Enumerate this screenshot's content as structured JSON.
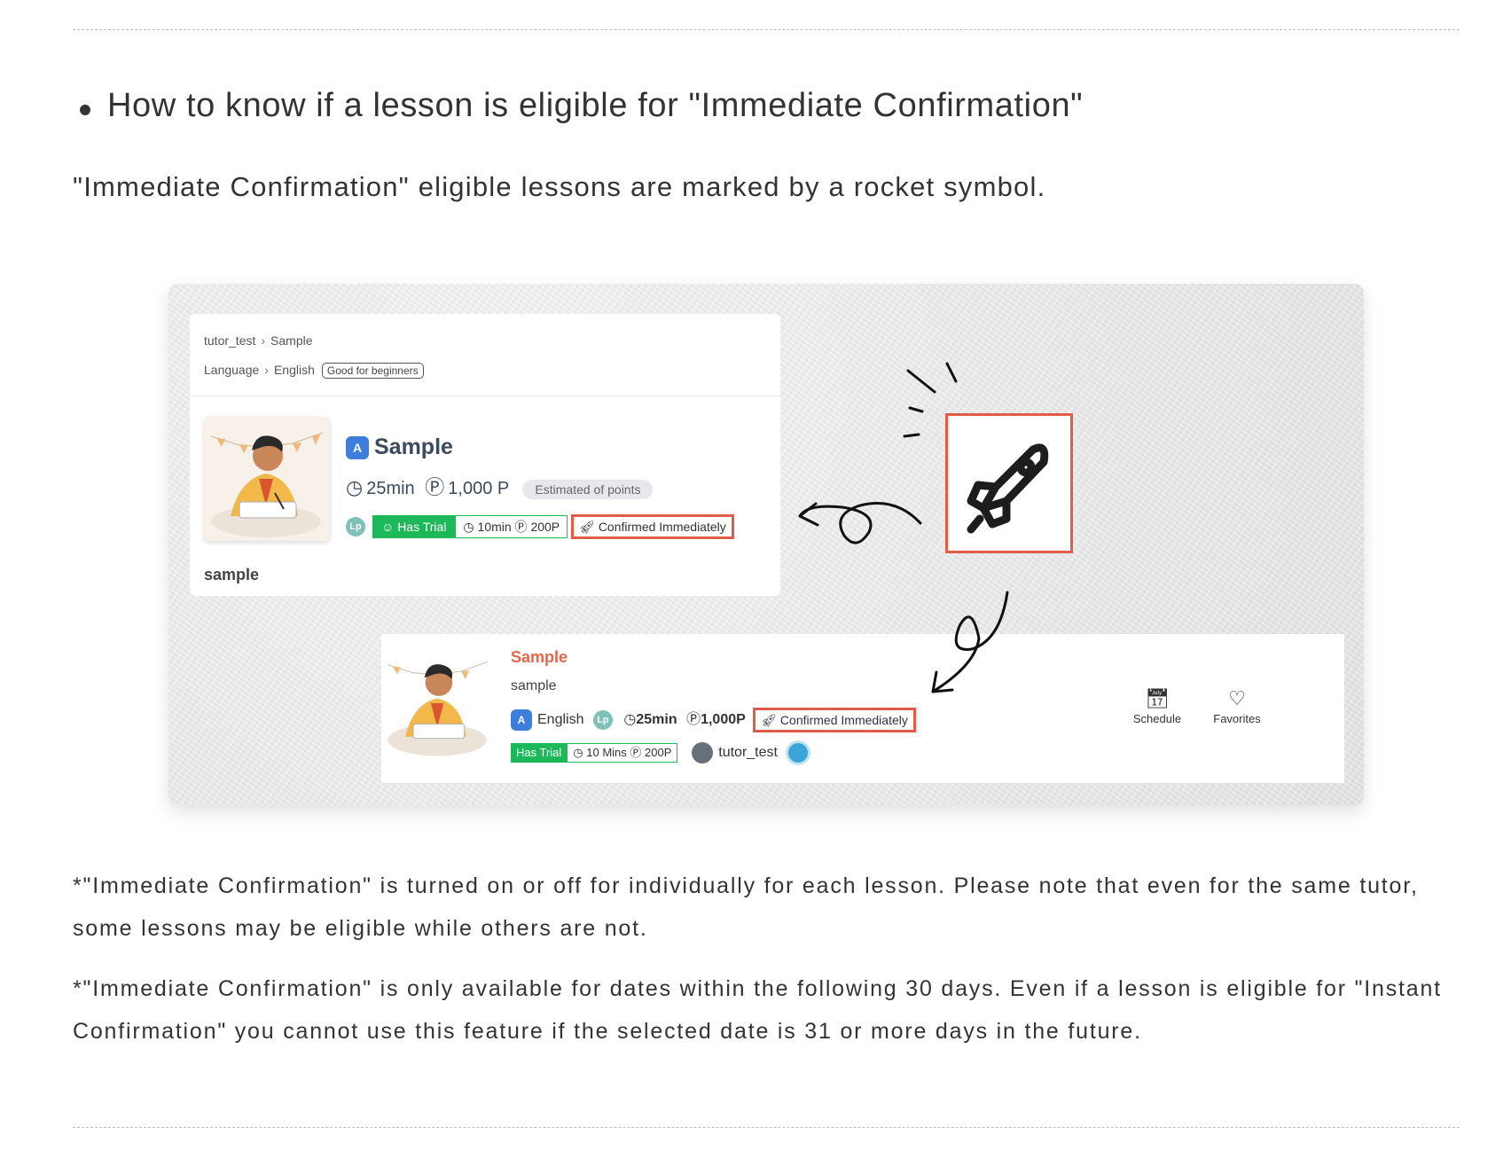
{
  "heading": "How to know if a lesson is eligible for \"Immediate Confirmation\"",
  "intro": "\"Immediate Confirmation\" eligible lessons are marked by a rocket symbol.",
  "figure": {
    "card1": {
      "crumb1": "tutor_test",
      "crumb2": "Sample",
      "crumb3": "Language",
      "crumb4": "English",
      "level_tag": "Good for beginners",
      "app_letter": "A",
      "title": "Sample",
      "duration": "25min",
      "points": "1,000 P",
      "estimate_tag": "Estimated of points",
      "lp_badge": "Lp",
      "trial_label": "Has Trial",
      "trial_detail": "10min Ⓟ 200P",
      "confirm_label": "Confirmed Immediately",
      "description": "sample"
    },
    "card2": {
      "title": "Sample",
      "subtitle": "sample",
      "app_letter": "A",
      "language": "English",
      "lp_badge": "Lp",
      "duration": "25min",
      "points": "1,000P",
      "confirm_label": "Confirmed Immediately",
      "trial_label": "Has Trial",
      "trial_detail": "10 Mins Ⓟ 200P",
      "tutor": "tutor_test",
      "schedule_label": "Schedule",
      "favorites_label": "Favorites"
    },
    "highlight_color": "#e05c46",
    "trial_color": "#1cb85a"
  },
  "note1": "*\"Immediate Confirmation\" is turned on or off for individually for each lesson. Please note that even for the same tutor, some lessons may be eligible while others are not.",
  "note2": "*\"Immediate Confirmation\" is only available for dates within the following 30 days. Even if a lesson is eligible for \"Instant Confirmation\" you cannot use this feature if the selected date is 31 or more days in the future."
}
